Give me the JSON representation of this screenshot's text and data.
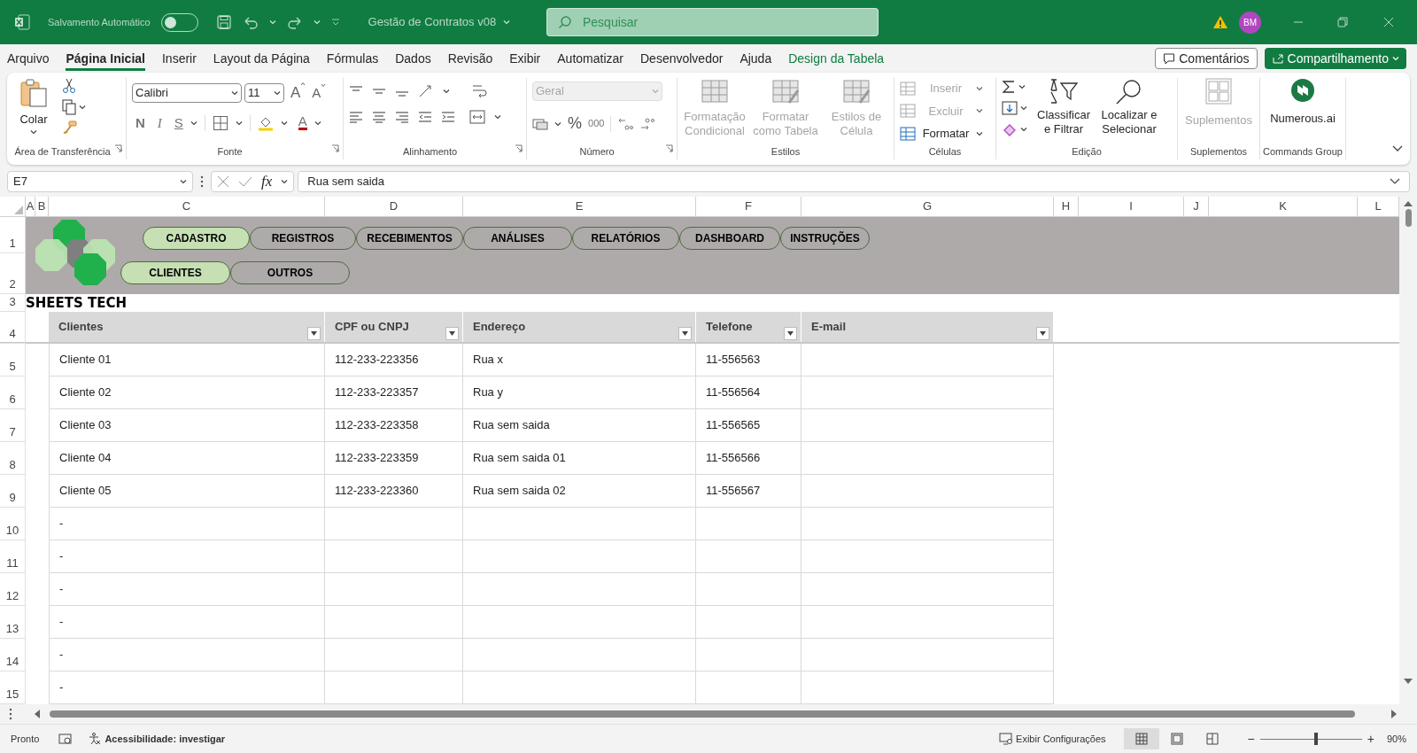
{
  "title_bar": {
    "autosave_label": "Salvamento Automático",
    "autosave_on": false,
    "document_title": "Gestão de Contratos v08",
    "search_placeholder": "Pesquisar",
    "user_initials": "BM"
  },
  "menu_tabs": [
    {
      "label": "Arquivo",
      "selected": false,
      "kind": "normal"
    },
    {
      "label": "Página Inicial",
      "selected": true,
      "kind": "normal"
    },
    {
      "label": "Inserir",
      "selected": false,
      "kind": "normal"
    },
    {
      "label": "Layout da Página",
      "selected": false,
      "kind": "normal"
    },
    {
      "label": "Fórmulas",
      "selected": false,
      "kind": "normal"
    },
    {
      "label": "Dados",
      "selected": false,
      "kind": "normal"
    },
    {
      "label": "Revisão",
      "selected": false,
      "kind": "normal"
    },
    {
      "label": "Exibir",
      "selected": false,
      "kind": "normal"
    },
    {
      "label": "Automatizar",
      "selected": false,
      "kind": "normal"
    },
    {
      "label": "Desenvolvedor",
      "selected": false,
      "kind": "normal"
    },
    {
      "label": "Ajuda",
      "selected": false,
      "kind": "normal"
    },
    {
      "label": "Design da Tabela",
      "selected": false,
      "kind": "contextual"
    }
  ],
  "comments_button": "Comentários",
  "share_button": "Compartilhamento",
  "ribbon": {
    "groups": [
      {
        "kind": "clipboard",
        "label": "Área de Transferência",
        "paste": "Colar"
      },
      {
        "kind": "font",
        "label": "Fonte",
        "font_name": "Calibri",
        "font_size": "11",
        "font_grow": "A",
        "font_shrink": "A",
        "bold": "N",
        "italic": "I",
        "underline": "S",
        "font_color": "A"
      },
      {
        "kind": "alignment",
        "label": "Alinhamento"
      },
      {
        "kind": "number",
        "label": "Número",
        "format": "Geral",
        "format_disabled": true,
        "percent": "%",
        "thousands": "000"
      },
      {
        "kind": "styles",
        "label": "Estilos",
        "items": [
          {
            "label": "Formatação Condicional",
            "disabled": true
          },
          {
            "label": "Formatar como Tabela",
            "disabled": true
          },
          {
            "label": "Estilos de Célula",
            "disabled": true
          }
        ]
      },
      {
        "kind": "cells",
        "label": "Células",
        "items": [
          {
            "label": "Inserir",
            "disabled": true
          },
          {
            "label": "Excluir",
            "disabled": true
          },
          {
            "label": "Formatar",
            "disabled": false
          }
        ]
      },
      {
        "kind": "editing",
        "label": "Edição",
        "items": [
          {
            "label": "Classificar e Filtrar"
          },
          {
            "label": "Localizar e Selecionar"
          }
        ]
      },
      {
        "kind": "addins",
        "label": "Suplementos",
        "button": "Suplementos",
        "disabled": true
      },
      {
        "kind": "commands",
        "label": "Commands Group",
        "button": "Numerous.ai"
      }
    ]
  },
  "formula_bar": {
    "name_box": "E7",
    "function_label": "fx",
    "formula": "Rua sem saida"
  },
  "column_headers": [
    "A",
    "B",
    "C",
    "D",
    "E",
    "F",
    "G",
    "H",
    "I",
    "J",
    "K",
    "L"
  ],
  "row_headers": [
    "1",
    "2",
    "3",
    "4",
    "5",
    "6",
    "7",
    "8",
    "9",
    "10",
    "11",
    "12",
    "13",
    "14",
    "15"
  ],
  "banner": {
    "nav_primary": [
      {
        "label": "CADASTRO",
        "selected": true
      },
      {
        "label": "REGISTROS",
        "selected": false
      },
      {
        "label": "RECEBIMENTOS",
        "selected": false
      },
      {
        "label": "ANÁLISES",
        "selected": false
      },
      {
        "label": "RELATÓRIOS",
        "selected": false
      },
      {
        "label": "DASHBOARD",
        "selected": false
      },
      {
        "label": "INSTRUÇÕES",
        "selected": false
      }
    ],
    "nav_secondary": [
      {
        "label": "CLIENTES",
        "selected": true
      },
      {
        "label": "OUTROS",
        "selected": false
      }
    ],
    "brand": "SHEETS TECH"
  },
  "table": {
    "columns": [
      "Clientes",
      "CPF ou CNPJ",
      "Endereço",
      "Telefone",
      "E-mail"
    ],
    "rows": [
      [
        "Cliente 01",
        "112-233-223356",
        "Rua x",
        "11-556563"
      ],
      [
        "Cliente 02",
        "112-233-223357",
        "Rua y",
        "11-556564"
      ],
      [
        "Cliente 03",
        "112-233-223358",
        "Rua sem saida",
        "11-556565"
      ],
      [
        "Cliente 04",
        "112-233-223359",
        "Rua sem saida 01",
        "11-556566"
      ],
      [
        "Cliente 05",
        "112-233-223360",
        "Rua sem saida 02",
        "11-556567"
      ],
      [
        "-"
      ],
      [
        "-"
      ],
      [
        "-"
      ],
      [
        "-"
      ],
      [
        "-"
      ],
      [
        "-"
      ]
    ]
  },
  "status_bar": {
    "status": "Pronto",
    "accessibility": "Acessibilidade: investigar",
    "display_settings": "Exibir Configurações",
    "views": [
      {
        "selected": true
      },
      {
        "selected": false
      },
      {
        "selected": false
      }
    ],
    "zoom_out": "−",
    "zoom_in": "+",
    "zoom": {
      "level": 0.55
    },
    "zoom_label": "90%"
  }
}
